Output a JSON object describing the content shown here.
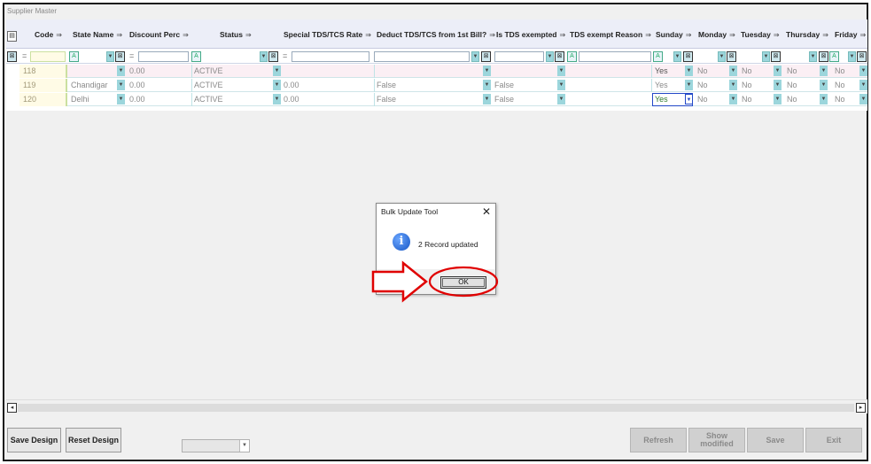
{
  "window": {
    "title": "Supplier Master"
  },
  "grid": {
    "columns": [
      "Code",
      "State Name",
      "Discount Perc",
      "Status",
      "Special TDS/TCS Rate",
      "Deduct TDS/TCS from 1st Bill?",
      "Is TDS exempted",
      "TDS exempt Reason",
      "Sunday",
      "Monday",
      "Tuesday",
      "Thursday",
      "Friday"
    ],
    "filter_eq": "=",
    "rows": [
      {
        "code": "118",
        "state": "",
        "discount": "0.00",
        "status": "ACTIVE",
        "special_rate": "",
        "deduct": "",
        "exempted": "",
        "reason": "",
        "sunday": "Yes",
        "monday": "No",
        "tuesday": "No",
        "thursday": "No",
        "friday": "No"
      },
      {
        "code": "119",
        "state": "Chandigar",
        "discount": "0.00",
        "status": "ACTIVE",
        "special_rate": "0.00",
        "deduct": "False",
        "exempted": "False",
        "reason": "",
        "sunday": "Yes",
        "monday": "No",
        "tuesday": "No",
        "thursday": "No",
        "friday": "No"
      },
      {
        "code": "120",
        "state": "Delhi",
        "discount": "0.00",
        "status": "ACTIVE",
        "special_rate": "0.00",
        "deduct": "False",
        "exempted": "False",
        "reason": "",
        "sunday": "Yes",
        "monday": "No",
        "tuesday": "No",
        "thursday": "No",
        "friday": "No"
      }
    ]
  },
  "dialog": {
    "title": "Bulk Update Tool",
    "message": "2 Record updated",
    "ok_label": "OK",
    "close_glyph": "✕"
  },
  "buttons": {
    "save_design": "Save Design",
    "reset_design": "Reset Design",
    "refresh": "Refresh",
    "show_modified": "Show modified",
    "save": "Save",
    "exit": "Exit"
  },
  "icons": {
    "info": "information-icon",
    "arrow": "red-arrow-annotation",
    "highlight": "red-ellipse-annotation"
  },
  "colors": {
    "annotation": "#e00000",
    "header_bg": "#eceef8",
    "dropdown_btn": "#9cd6dc"
  }
}
